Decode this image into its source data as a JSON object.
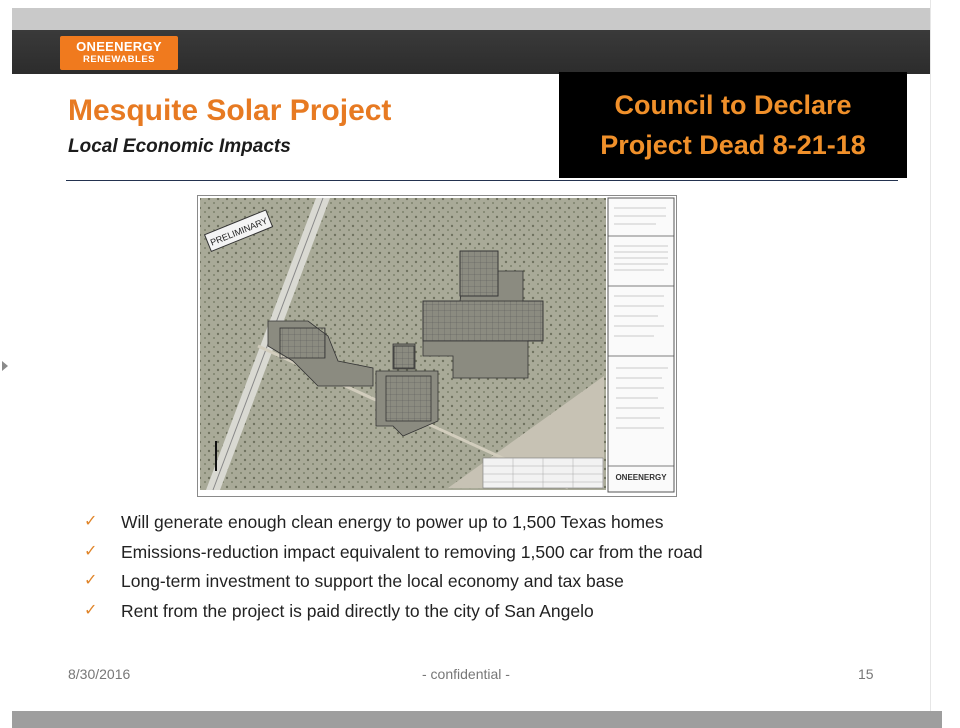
{
  "logo": {
    "line1": "ONEENERGY",
    "line2": "RENEWABLES"
  },
  "slide": {
    "title": "Mesquite Solar Project",
    "subtitle": "Local Economic Impacts",
    "banner": {
      "line1": "Council to Declare",
      "line2": "Project Dead 8-21-18"
    },
    "map_stamp": "PRELIMINARY",
    "map_logo": "ONEENERGY",
    "bullets": [
      "Will generate enough clean energy to power up to 1,500 Texas homes",
      "Emissions-reduction impact equivalent to removing 1,500 car from the road",
      "Long-term investment to support the local economy and tax base",
      "Rent from the project is paid directly to the city of San Angelo"
    ],
    "footer": {
      "date": "8/30/2016",
      "confidential": "- confidential -",
      "page": "15"
    }
  },
  "colors": {
    "accent": "#e77a22",
    "banner_bg": "#000000",
    "banner_text": "#f0902a",
    "brand_bar": "#2e2e2e",
    "divider": "#23324f"
  },
  "icons": {
    "bullet": "checkmark-icon",
    "nav": "triangle-right-icon"
  }
}
